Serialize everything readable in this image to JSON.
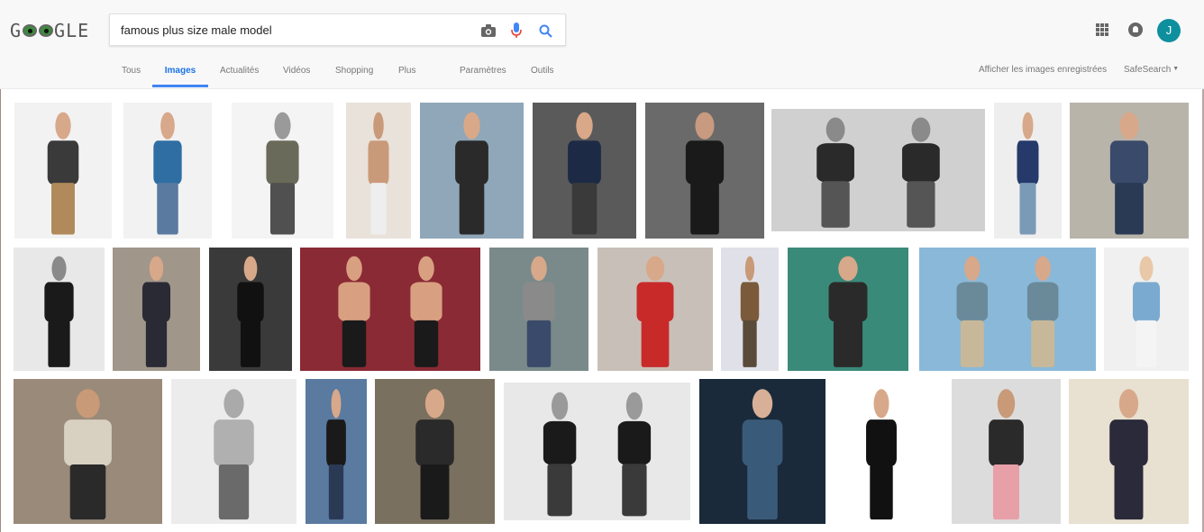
{
  "logo": {
    "text": "GOOGLE",
    "g1": "G",
    "rest": "GLE"
  },
  "search": {
    "query": "famous plus size male model",
    "placeholder": ""
  },
  "tabs": {
    "all": "Tous",
    "images": "Images",
    "news": "Actualités",
    "videos": "Vidéos",
    "shopping": "Shopping",
    "more": "Plus",
    "settings": "Paramètres",
    "tools": "Outils"
  },
  "right": {
    "saved": "Afficher les images enregistrées",
    "safesearch": "SafeSearch"
  },
  "user": {
    "initial": "J"
  },
  "colors": {
    "accent": "#4285f4",
    "avatar": "#0e8f9e"
  },
  "results": {
    "row1": [
      {
        "bg": "#f2f2f2",
        "shirt": "#3a3a3a",
        "pants": "#b08a5a",
        "skin": "#d8a88a"
      },
      {
        "bg": "#f2f2f2",
        "shirt": "#2f6ea3",
        "pants": "#5a7aa0",
        "skin": "#d8a88a"
      },
      {
        "bg": "#f4f4f4",
        "shirt": "#6a6a5a",
        "pants": "#505050",
        "skin": "#9a9a9a"
      },
      {
        "bg": "#e9e2da",
        "shirt": "#c99a7a",
        "pants": "#eeeeee",
        "skin": "#c99a7a"
      },
      {
        "bg": "#8fa7b8",
        "shirt": "#2a2a2a",
        "pants": "#2a2a2a",
        "skin": "#d9a888"
      },
      {
        "bg": "#5a5a5a",
        "shirt": "#1d2a45",
        "pants": "#3a3a3a",
        "skin": "#d9a888"
      },
      {
        "bg": "#6a6a6a",
        "shirt": "#1a1a1a",
        "pants": "#1a1a1a",
        "skin": "#c89a80"
      },
      {
        "bg": "#d0d0d0",
        "shirt": "#2a2a2a",
        "pants": "#555555",
        "skin": "#8a8a8a"
      },
      {
        "bg": "#eeeeee",
        "shirt": "#253a6a",
        "pants": "#7a9ab8",
        "skin": "#d8a88a"
      },
      {
        "bg": "#b8b4aa",
        "shirt": "#3a4a6a",
        "pants": "#2a3a55",
        "skin": "#d8a88a"
      }
    ],
    "row2": [
      {
        "bg": "#e8e8e8",
        "shirt": "#1a1a1a",
        "pants": "#1a1a1a",
        "skin": "#8a8a8a"
      },
      {
        "bg": "#a0968a",
        "shirt": "#2a2a35",
        "pants": "#2a2a35",
        "skin": "#d8a88a"
      },
      {
        "bg": "#3a3a3a",
        "shirt": "#111111",
        "pants": "#111111",
        "skin": "#d8a88a"
      },
      {
        "bg": "#8a2a35",
        "shirt": "#d8a080",
        "pants": "#1a1a1a",
        "skin": "#d8a080"
      },
      {
        "bg": "#7a8a8a",
        "shirt": "#8a8a8a",
        "pants": "#3a4a6a",
        "skin": "#d8a88a"
      },
      {
        "bg": "#c8c0b8",
        "shirt": "#c82a2a",
        "pants": "#c82a2a",
        "skin": "#d8a88a"
      },
      {
        "bg": "#e0e0e8",
        "shirt": "#7a5a3a",
        "pants": "#5a4a3a",
        "skin": "#c89a78"
      },
      {
        "bg": "#3a8a7a",
        "shirt": "#2a2a2a",
        "pants": "#2a2a2a",
        "skin": "#d8a88a"
      },
      {
        "bg": "#8ab8d8",
        "shirt": "#6a8a9a",
        "pants": "#c8b89a",
        "skin": "#d8a88a"
      },
      {
        "bg": "#f0f0f0",
        "shirt": "#7aaad0",
        "pants": "#f4f4f4",
        "skin": "#e8c8a8"
      }
    ],
    "row3": [
      {
        "bg": "#9a8a7a",
        "shirt": "#d8d0c0",
        "pants": "#2a2a2a",
        "skin": "#c89a78"
      },
      {
        "bg": "#ececec",
        "shirt": "#b0b0b0",
        "pants": "#6a6a6a",
        "skin": "#aaaaaa"
      },
      {
        "bg": "#5a7aa0",
        "shirt": "#1a1a1a",
        "pants": "#2a3a55",
        "skin": "#d8a88a"
      },
      {
        "bg": "#7a7060",
        "shirt": "#2a2a2a",
        "pants": "#1a1a1a",
        "skin": "#d8a88a"
      },
      {
        "bg": "#e8e8e8",
        "shirt": "#1a1a1a",
        "pants": "#3a3a3a",
        "skin": "#9a9a9a"
      },
      {
        "bg": "#1a2a3a",
        "shirt": "#3a5a7a",
        "pants": "#3a5a7a",
        "skin": "#d8b098"
      },
      {
        "bg": "#ffffff",
        "shirt": "#111111",
        "pants": "#111111",
        "skin": "#d8a88a"
      },
      {
        "bg": "#dcdcdc",
        "shirt": "#2a2a2a",
        "pants": "#e8a0a8",
        "skin": "#c89a78"
      },
      {
        "bg": "#e8e0d0",
        "shirt": "#2a2a3a",
        "pants": "#2a2a3a",
        "skin": "#d8a88a"
      }
    ]
  }
}
